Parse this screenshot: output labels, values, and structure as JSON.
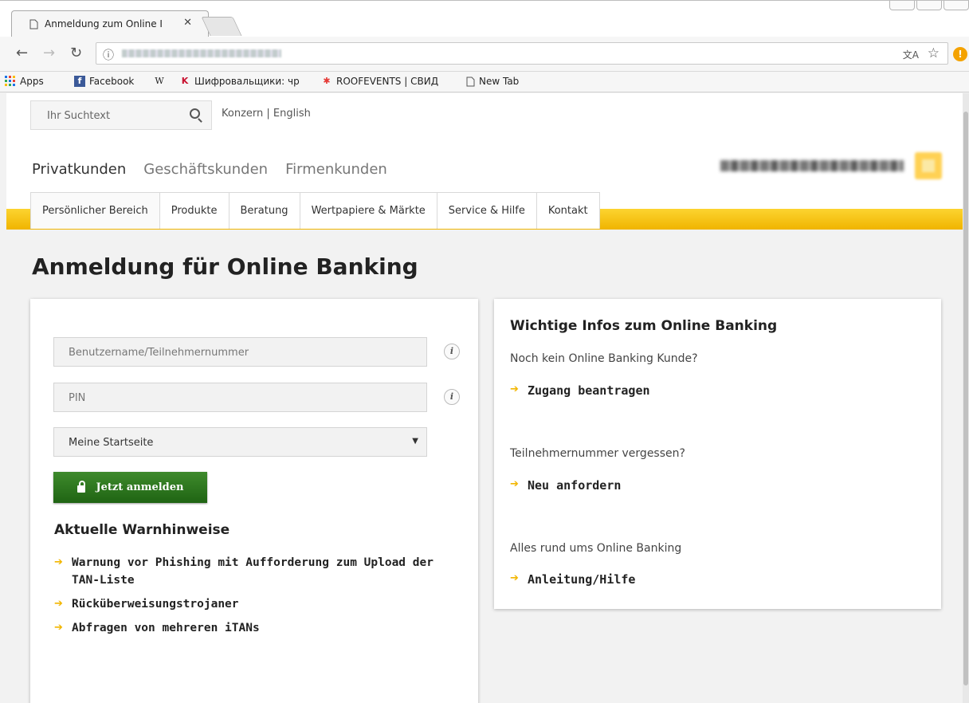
{
  "browser": {
    "tab_title": "Anmeldung zum Online I",
    "tab_close": "✕",
    "bookmarks": [
      {
        "label": "Apps",
        "icon": "apps-grid-icon"
      },
      {
        "label": "Facebook",
        "icon": "facebook-icon"
      },
      {
        "label": "",
        "icon": "wikipedia-icon",
        "glyph": "W"
      },
      {
        "label": "Шифровальщики: чр",
        "icon": "kaspersky-icon"
      },
      {
        "label": "ROOFEVENTS | СВИД",
        "icon": "roofevents-icon"
      },
      {
        "label": "New Tab",
        "icon": "page-icon"
      }
    ]
  },
  "header": {
    "search_placeholder": "Ihr Suchtext",
    "language_links": "Konzern | English",
    "segments": [
      "Privatkunden",
      "Geschäftskunden",
      "Firmenkunden"
    ],
    "active_segment": "Privatkunden"
  },
  "mainnav": {
    "items": [
      "Persönlicher Bereich",
      "Produkte",
      "Beratung",
      "Wertpapiere & Märkte",
      "Service & Hilfe",
      "Kontakt"
    ]
  },
  "page": {
    "title": "Anmeldung für Online Banking"
  },
  "login": {
    "username_placeholder": "Benutzername/Teilnehmernummer",
    "pin_placeholder": "PIN",
    "start_page_selected": "Meine Startseite",
    "submit_label": "Jetzt anmelden",
    "info_glyph": "i"
  },
  "warnings": {
    "heading": "Aktuelle Warnhinweise",
    "items": [
      "Warnung vor Phishing mit Aufforderung zum Upload der TAN-Liste",
      "Rücküberweisungstrojaner",
      "Abfragen von mehreren iTANs"
    ]
  },
  "infos": {
    "heading": "Wichtige Infos zum Online Banking",
    "blocks": [
      {
        "text": "Noch kein Online Banking Kunde?",
        "link": "Zugang beantragen"
      },
      {
        "text": "Teilnehmernummer vergessen?",
        "link": "Neu anfordern"
      },
      {
        "text": "Alles rund ums Online Banking",
        "link": "Anleitung/Hilfe"
      }
    ]
  },
  "colors": {
    "accent_yellow": "#f5c300",
    "button_green": "#2e7a1f",
    "arrow_yellow": "#f2b600"
  }
}
